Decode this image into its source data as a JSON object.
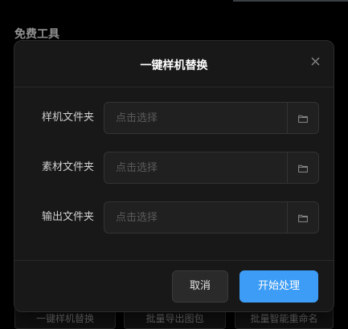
{
  "background": {
    "section_title": "免费工具",
    "tools": [
      "一键样机替换",
      "批量导出图包",
      "批量智能重命名"
    ]
  },
  "modal": {
    "title": "一键样机替换",
    "close_icon": "close-icon",
    "rows": [
      {
        "label": "样机文件夹",
        "placeholder": "点击选择",
        "value": "",
        "icon": "folder-icon"
      },
      {
        "label": "素材文件夹",
        "placeholder": "点击选择",
        "value": "",
        "icon": "folder-icon"
      },
      {
        "label": "输出文件夹",
        "placeholder": "点击选择",
        "value": "",
        "icon": "folder-icon"
      }
    ],
    "cancel_label": "取消",
    "submit_label": "开始处理"
  },
  "colors": {
    "primary": "#3d9cf5",
    "modal_bg": "#181818",
    "page_bg": "#000000"
  }
}
